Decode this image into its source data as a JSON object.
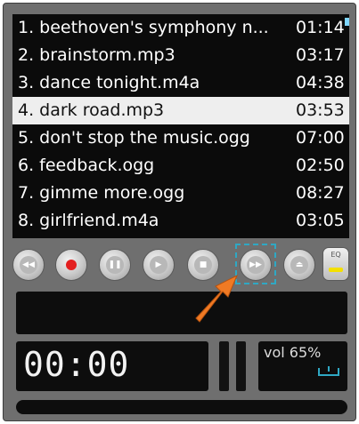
{
  "playlist": {
    "tracks": [
      {
        "title": "1. beethoven's symphony n...",
        "time": "01:14"
      },
      {
        "title": "2. brainstorm.mp3",
        "time": "03:17"
      },
      {
        "title": "3. dance tonight.m4a",
        "time": "04:38"
      },
      {
        "title": "4. dark road.mp3",
        "time": "03:53"
      },
      {
        "title": "5. don't stop the music.ogg",
        "time": "07:00"
      },
      {
        "title": "6. feedback.ogg",
        "time": "02:50"
      },
      {
        "title": "7. gimme more.ogg",
        "time": "08:27"
      },
      {
        "title": "8. girlfriend.m4a",
        "time": "03:05"
      }
    ],
    "selected_index": 3,
    "selected_color": "#eeeeee",
    "accent_color": "#7fd6ff"
  },
  "controls": {
    "buttons": [
      {
        "name": "rewind",
        "icon": "rewind-icon",
        "glyph": "◀◀"
      },
      {
        "name": "record",
        "icon": "record-icon",
        "glyph": "●"
      },
      {
        "name": "pause",
        "icon": "pause-icon",
        "glyph": "❚❚"
      },
      {
        "name": "play",
        "icon": "play-icon",
        "glyph": "▶"
      },
      {
        "name": "stop",
        "icon": "stop-icon",
        "glyph": "■"
      },
      {
        "name": "fast-forward",
        "icon": "fast-forward-icon",
        "glyph": "▶▶"
      },
      {
        "name": "eject",
        "icon": "eject-icon",
        "glyph": "⏏"
      }
    ],
    "highlighted": "fast-forward",
    "eq_label": "EQ",
    "record_color": "#e32020",
    "eq_color": "#f4e000"
  },
  "display": {
    "time": "00:00",
    "volume": "vol 65%"
  },
  "annotation": {
    "arrow_color": "#f07a24"
  }
}
